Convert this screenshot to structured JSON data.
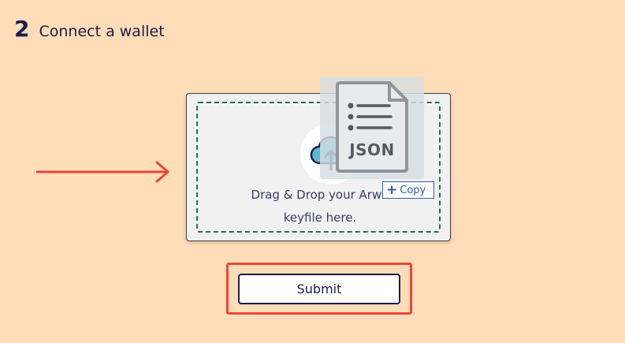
{
  "step": {
    "number": "2",
    "title": "Connect a wallet"
  },
  "dropzone": {
    "line1": "Drag & Drop your Arwe",
    "line2": "keyfile here.",
    "icon": "cloud-upload-icon"
  },
  "drag_ghost": {
    "file_type_label": "JSON",
    "icon": "json-file-icon",
    "copy_badge_label": "Copy"
  },
  "submit": {
    "label": "Submit"
  },
  "colors": {
    "background": "#ffddb8",
    "text_dark": "#1e1b4b",
    "dashed_border": "#2e6b5e",
    "annotation_red": "#f04438",
    "upload_icon": "#5bb8d4"
  }
}
